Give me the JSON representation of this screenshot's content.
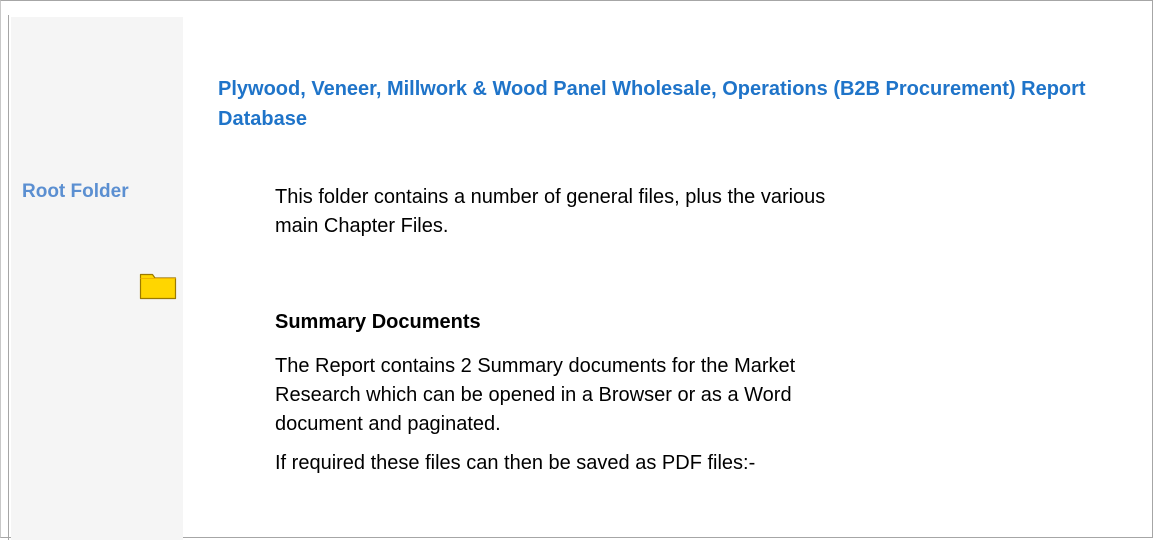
{
  "sidebar": {
    "title": "Root Folder",
    "folder_icon": "folder-icon"
  },
  "header": {
    "title": "Plywood, Veneer, Millwork & Wood Panel Wholesale, Operations (B2B Procurement) Report Database"
  },
  "main": {
    "intro": "This folder contains a number of general files, plus the various main Chapter Files.",
    "section_heading": "Summary Documents",
    "summary_text": "The Report contains 2 Summary documents for the Market Research which can be opened in a Browser or as a Word document and paginated.",
    "pdf_note": "If required these files can then be saved as PDF files:-"
  },
  "colors": {
    "title_blue": "#1f74c9",
    "sidebar_blue": "#5b8fd1",
    "sidebar_bg": "#f5f5f5",
    "folder_fill": "#ffd600",
    "folder_stroke": "#9b7a00"
  }
}
